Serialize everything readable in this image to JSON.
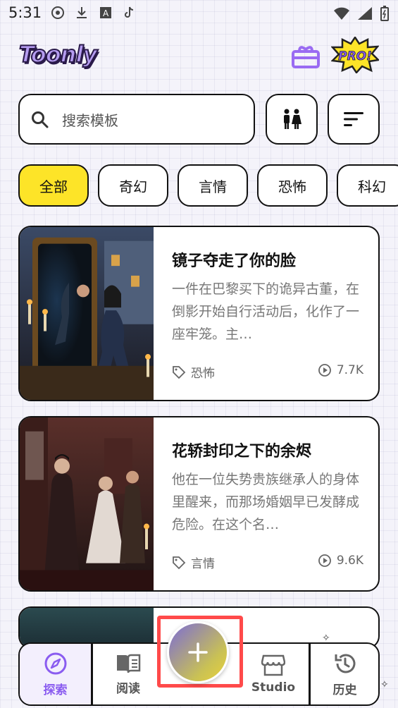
{
  "status_bar": {
    "time": "5:31"
  },
  "header": {
    "logo_text": "Toonly",
    "pro_badge": "PRO!"
  },
  "search": {
    "placeholder": "搜索模板"
  },
  "categories": [
    {
      "label": "全部",
      "active": true
    },
    {
      "label": "奇幻",
      "active": false
    },
    {
      "label": "言情",
      "active": false
    },
    {
      "label": "恐怖",
      "active": false
    },
    {
      "label": "科幻",
      "active": false
    }
  ],
  "cards": [
    {
      "title": "镜子夺走了你的脸",
      "description": "一件在巴黎买下的诡异古董，在倒影开始自行活动后，化作了一座牢笼。主…",
      "tag": "恐怖",
      "views": "7.7K"
    },
    {
      "title": "花轿封印之下的余烬",
      "description": "他在一位失势贵族继承人的身体里醒来，而那场婚姻早已发酵成危险。在这个名…",
      "tag": "言情",
      "views": "9.6K"
    }
  ],
  "nav": {
    "explore": "探索",
    "read": "阅读",
    "studio": "Studio",
    "history": "历史"
  },
  "colors": {
    "accent_purple": "#8a5cf0",
    "chip_active_yellow": "#fde428",
    "fab_highlight_red": "#ff4a4a"
  }
}
